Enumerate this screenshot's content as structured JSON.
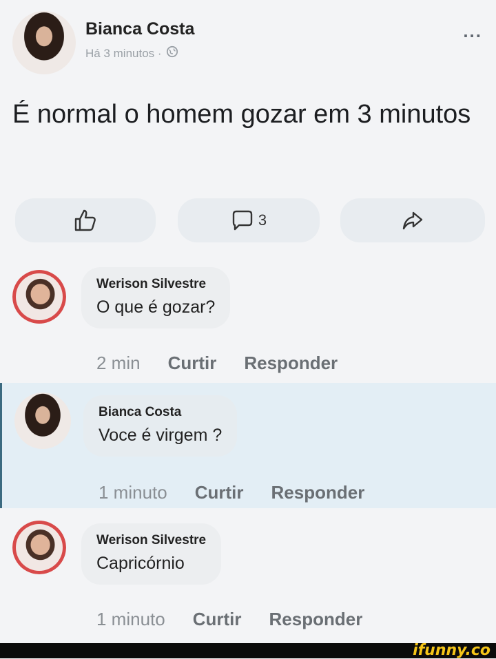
{
  "post": {
    "author": "Bianca Costa",
    "time": "Há 3 minutos ·",
    "more": "...",
    "text": "É normal o homem gozar em 3 minutos"
  },
  "actions": {
    "comment_count": "3"
  },
  "comments": [
    {
      "name": "Werison Silvestre",
      "text": "O que é gozar?",
      "time": "2 min",
      "like": "Curtir",
      "reply": "Responder"
    },
    {
      "name": "Bianca Costa",
      "text": "Voce é virgem ?",
      "time": "1 minuto",
      "like": "Curtir",
      "reply": "Responder"
    },
    {
      "name": "Werison Silvestre",
      "text": "Capricórnio",
      "time": "1 minuto",
      "like": "Curtir",
      "reply": "Responder"
    }
  ],
  "watermark": "ifunny.co"
}
